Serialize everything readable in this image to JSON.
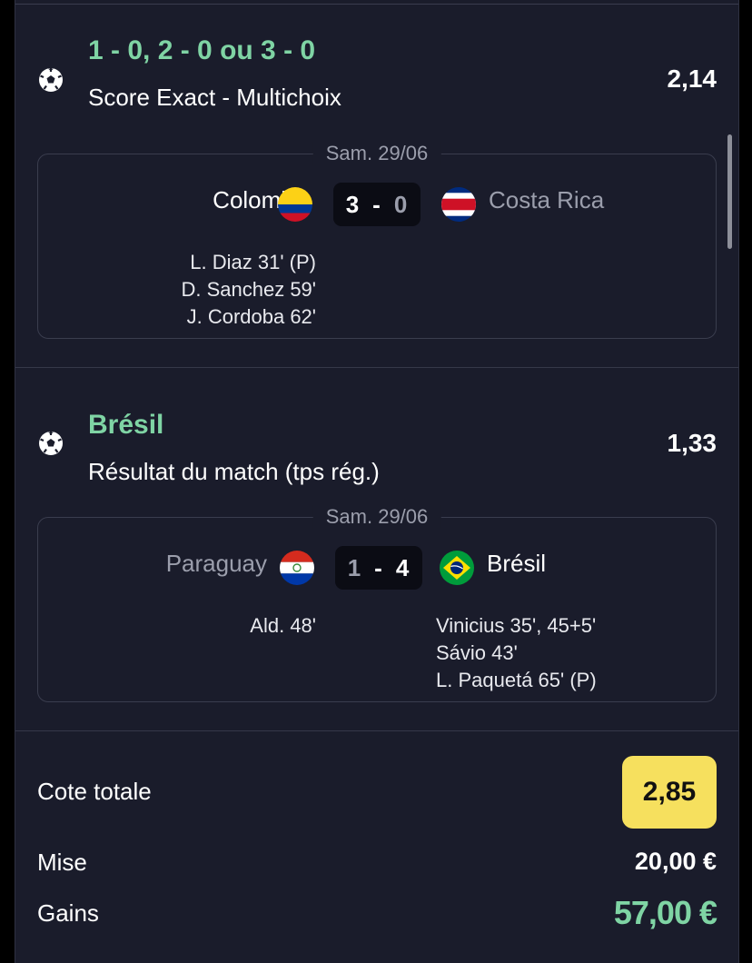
{
  "bets": [
    {
      "pick": "1 - 0, 2 - 0 ou 3 - 0",
      "market": "Score Exact - Multichoix",
      "odds": "2,14",
      "date": "Sam. 29/06",
      "home_team": "Colombie",
      "away_team": "Costa Rica",
      "home_score": "3",
      "away_score": "0",
      "winner": "home",
      "home_scorers": [
        "L. Diaz 31' (P)",
        "D. Sanchez 59'",
        "J. Cordoba 62'"
      ],
      "away_scorers": []
    },
    {
      "pick": "Brésil",
      "market": "Résultat du match (tps rég.)",
      "odds": "1,33",
      "date": "Sam. 29/06",
      "home_team": "Paraguay",
      "away_team": "Brésil",
      "home_score": "1",
      "away_score": "4",
      "winner": "away",
      "home_scorers": [
        "Ald. 48'"
      ],
      "away_scorers": [
        "Vinicius 35', 45+5'",
        "Sávio 43'",
        "L. Paquetá 65' (P)"
      ]
    }
  ],
  "summary": {
    "total_odds_label": "Cote totale",
    "total_odds_value": "2,85",
    "stake_label": "Mise",
    "stake_value": "20,00 €",
    "gains_label": "Gains",
    "gains_value": "57,00 €"
  },
  "colors": {
    "background": "#1a1c2b",
    "accent_green": "#7fd4a4",
    "odds_badge": "#f6e05e",
    "muted_text": "#9b9eac"
  },
  "icons": [
    "soccer-ball-icon",
    "colombia-flag-icon",
    "costa-rica-flag-icon",
    "paraguay-flag-icon",
    "brazil-flag-icon"
  ]
}
